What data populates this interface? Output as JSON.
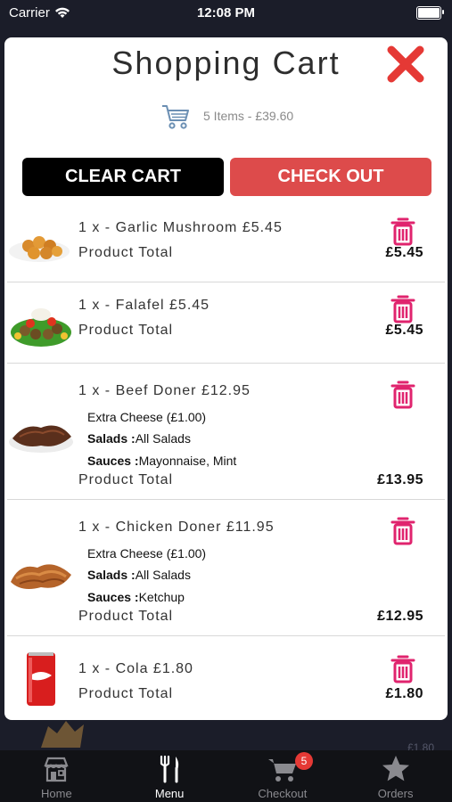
{
  "status_bar": {
    "carrier": "Carrier",
    "time": "12:08 PM"
  },
  "cart": {
    "title": "Shopping Cart",
    "summary": "5 Items - £39.60",
    "clear_label": "CLEAR CART",
    "checkout_label": "CHECK OUT",
    "product_total_label": "Product Total",
    "items": [
      {
        "line": "1 x - Garlic Mushroom £5.45",
        "total": "£5.45",
        "options": []
      },
      {
        "line": "1 x - Falafel £5.45",
        "total": "£5.45",
        "options": []
      },
      {
        "line": "1 x - Beef Doner £12.95",
        "total": "£13.95",
        "options": [
          {
            "label": "",
            "value": "Extra Cheese (£1.00)"
          },
          {
            "label": "Salads :",
            "value": "All Salads"
          },
          {
            "label": "Sauces :",
            "value": "Mayonnaise, Mint"
          }
        ]
      },
      {
        "line": "1 x - Chicken Doner £11.95",
        "total": "£12.95",
        "options": [
          {
            "label": "",
            "value": "Extra Cheese (£1.00)"
          },
          {
            "label": "Salads :",
            "value": "All Salads"
          },
          {
            "label": "Sauces :",
            "value": "Ketchup"
          }
        ]
      },
      {
        "line": "1 x - Cola £1.80",
        "total": "£1.80",
        "options": []
      }
    ]
  },
  "background_peek": {
    "price": "£1.80"
  },
  "tabbar": {
    "tabs": [
      {
        "label": "Home",
        "icon": "store-icon"
      },
      {
        "label": "Menu",
        "icon": "cutlery-icon"
      },
      {
        "label": "Checkout",
        "icon": "cart-icon"
      },
      {
        "label": "Orders",
        "icon": "star-icon"
      }
    ],
    "checkout_badge": "5"
  },
  "colors": {
    "accent": "#dd4b4b",
    "trash": "#e0246e",
    "close": "#e53935",
    "tabbar_bg": "#111216"
  }
}
